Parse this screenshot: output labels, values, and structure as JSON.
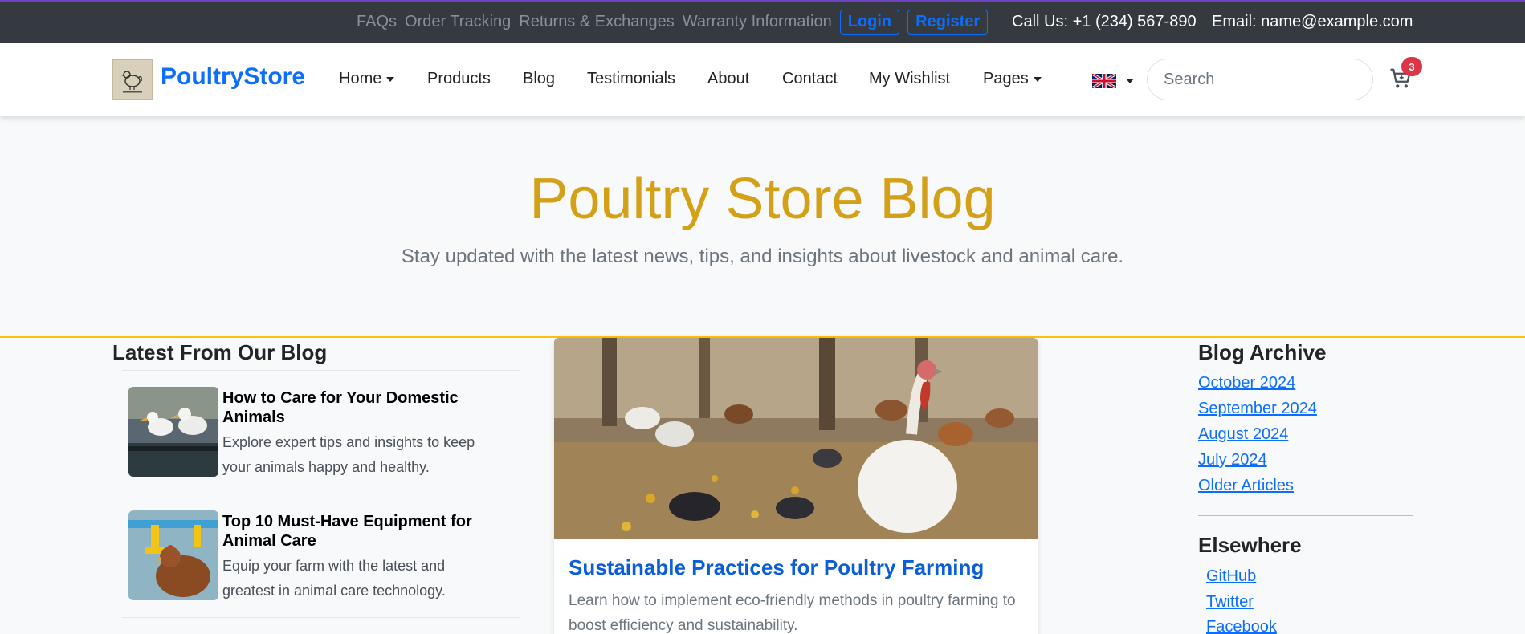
{
  "topbar": {
    "links": [
      "FAQs",
      "Order Tracking",
      "Returns & Exchanges",
      "Warranty Information"
    ],
    "login_label": "Login",
    "register_label": "Register",
    "phone_label": "Call Us:",
    "phone_value": "+1 (234) 567-890",
    "email_label": "Email:",
    "email_value": "name@example.com"
  },
  "navbar": {
    "brand": "PoultryStore",
    "items": [
      {
        "label": "Home",
        "dropdown": true
      },
      {
        "label": "Products",
        "dropdown": false
      },
      {
        "label": "Blog",
        "dropdown": false
      },
      {
        "label": "Testimonials",
        "dropdown": false
      },
      {
        "label": "About",
        "dropdown": false
      },
      {
        "label": "Contact",
        "dropdown": false
      },
      {
        "label": "My Wishlist",
        "dropdown": false
      },
      {
        "label": "Pages",
        "dropdown": true
      }
    ],
    "language_icon": "uk-flag-icon",
    "search_placeholder": "Search",
    "cart_icon": "cart-icon",
    "cart_count": "3"
  },
  "hero": {
    "title": "Poultry Store Blog",
    "subtitle": "Stay updated with the latest news, tips, and insights about livestock and animal care."
  },
  "latest": {
    "heading": "Latest From Our Blog",
    "items": [
      {
        "title": "How to Care for Your Domestic Animals",
        "description": "Explore expert tips and insights to keep your animals happy and healthy."
      },
      {
        "title": "Top 10 Must-Have Equipment for Animal Care",
        "description": "Equip your farm with the latest and greatest in animal care technology."
      }
    ]
  },
  "featured": {
    "title": "Sustainable Practices for Poultry Farming",
    "description": "Learn how to implement eco-friendly methods in poultry farming to boost efficiency and sustainability."
  },
  "archive": {
    "heading": "Blog Archive",
    "links": [
      "October 2024",
      "September 2024",
      "August 2024",
      "July 2024",
      "Older Articles"
    ]
  },
  "elsewhere": {
    "heading": "Elsewhere",
    "links": [
      "GitHub",
      "Twitter",
      "Facebook"
    ]
  },
  "colors": {
    "brand": "#0d6efd",
    "hero_title": "#d4a017",
    "hero_line": "#ffc107",
    "badge": "#dc3545",
    "topbar": "#343a40"
  }
}
